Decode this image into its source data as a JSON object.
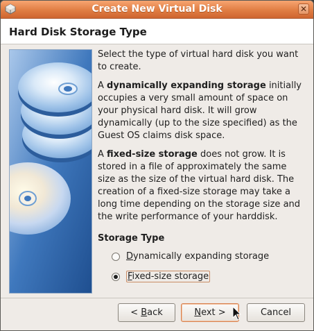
{
  "window": {
    "title": "Create New Virtual Disk",
    "close_glyph": "✕",
    "accent_color": "#e07d43"
  },
  "header": {
    "title": "Hard Disk Storage Type"
  },
  "content": {
    "intro": "Select the type of virtual hard disk you want to create.",
    "dynamic_bold": "dynamically expanding storage",
    "dynamic_prefix": "A ",
    "dynamic_rest": " initially occupies a very small amount of space on your physical hard disk. It will grow dynamically (up to the size specified) as the Guest OS claims disk space.",
    "fixed_prefix": "A ",
    "fixed_bold": "fixed-size storage",
    "fixed_rest": " does not grow. It is stored in a file of approximately the same size as the size of the virtual hard disk. The creation of a fixed-size storage may take a long time depending on the storage size and the write performance of your harddisk.",
    "storage_type_label": "Storage Type"
  },
  "options": [
    {
      "mnemonic": "D",
      "rest": "ynamically expanding storage",
      "checked": false
    },
    {
      "mnemonic": "F",
      "rest": "ixed-size storage",
      "checked": true
    }
  ],
  "buttons": {
    "back_prefix": "< ",
    "back_mnemonic": "B",
    "back_rest": "ack",
    "next_mnemonic": "N",
    "next_rest": "ext >",
    "cancel": "Cancel"
  },
  "icons": {
    "title_icon": "virtualbox-icon",
    "side_image": "disk-platters-illustration",
    "cursor": "mouse-pointer-icon"
  }
}
